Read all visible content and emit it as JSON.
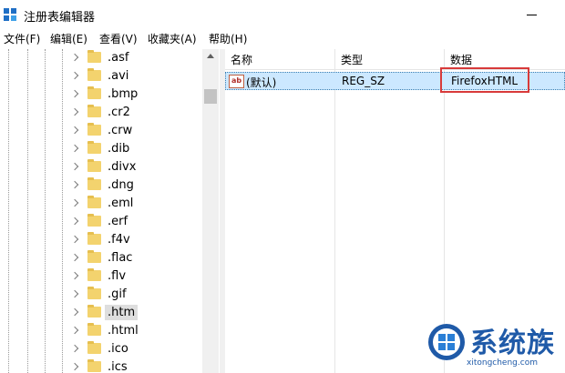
{
  "window": {
    "title": "注册表编辑器"
  },
  "menu": [
    "文件(F)",
    "编辑(E)",
    "查看(V)",
    "收藏夹(A)",
    "帮助(H)"
  ],
  "tree": {
    "items": [
      ".asf",
      ".avi",
      ".bmp",
      ".cr2",
      ".crw",
      ".dib",
      ".divx",
      ".dng",
      ".eml",
      ".erf",
      ".f4v",
      ".flac",
      ".flv",
      ".gif",
      ".htm",
      ".html",
      ".ico",
      ".ics"
    ],
    "selected": ".htm"
  },
  "list": {
    "columns": [
      "名称",
      "类型",
      "数据"
    ],
    "rows": [
      {
        "name": "(默认)",
        "type": "REG_SZ",
        "data": "FirefoxHTML",
        "icon": "string-value-icon"
      }
    ]
  },
  "watermark": {
    "text": "系统族",
    "url": "xitongcheng.com"
  },
  "colors": {
    "selection": "#cce8ff",
    "highlight": "#d83a3a",
    "brand": "#1f5aa8",
    "folder": "#f3d36e"
  }
}
